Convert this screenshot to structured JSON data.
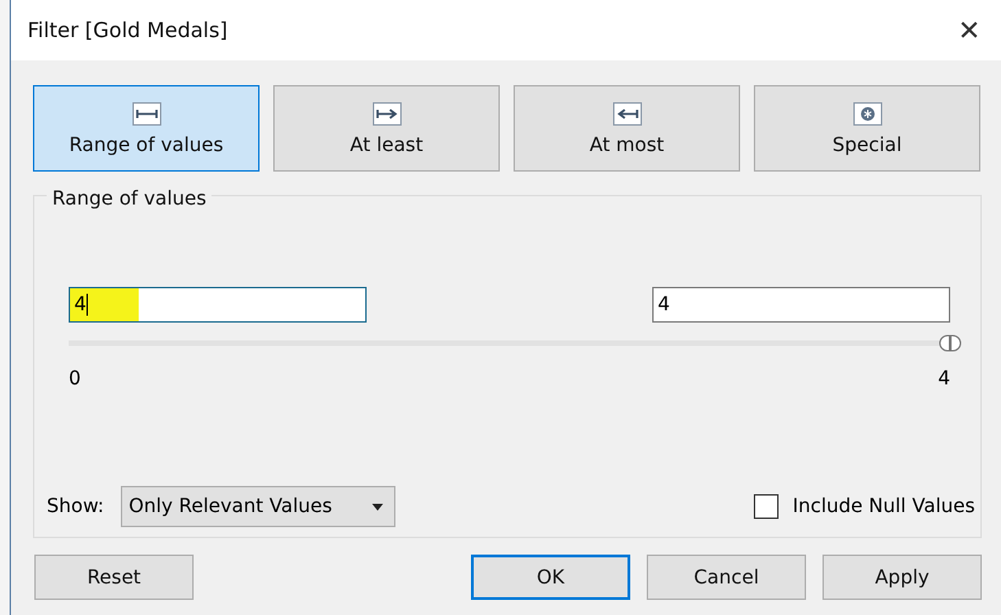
{
  "window": {
    "title": "Filter [Gold Medals]",
    "close": "✕"
  },
  "tabs": [
    {
      "label": "Range of values",
      "kind": "range",
      "selected": true
    },
    {
      "label": "At least",
      "kind": "at_least",
      "selected": false
    },
    {
      "label": "At most",
      "kind": "at_most",
      "selected": false
    },
    {
      "label": "Special",
      "kind": "special",
      "selected": false
    }
  ],
  "range": {
    "title": "Range of values",
    "min_value": "4",
    "max_value": "4",
    "thumbs": [
      {
        "level": 1
      },
      {
        "level": 1
      }
    ],
    "min_label": "0",
    "max_label": "4"
  },
  "show": {
    "label": "Show:",
    "value": "Only Relevant Values"
  },
  "include_null": {
    "label": "Include Null Values",
    "checked": false
  },
  "buttons": [
    {
      "label": "Reset",
      "default": false
    },
    {
      "label": "OK",
      "default": true
    },
    {
      "label": "Cancel",
      "default": false
    },
    {
      "label": "Apply",
      "default": false
    }
  ]
}
